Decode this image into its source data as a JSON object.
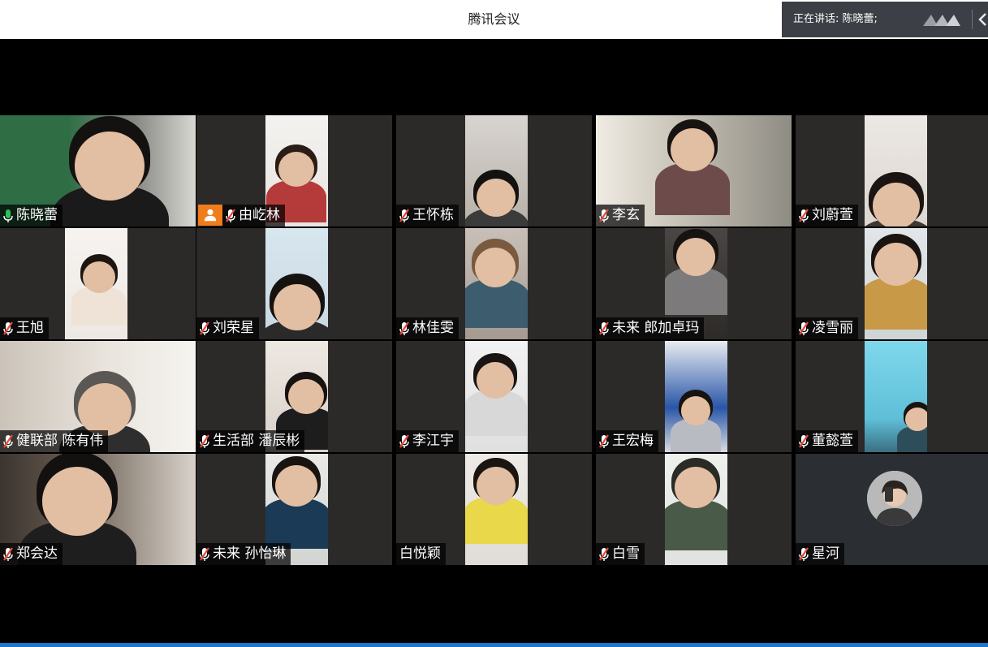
{
  "app": {
    "title": "腾讯会议"
  },
  "speaker": {
    "label": "正在讲话: 陈晓蕾;"
  },
  "colors": {
    "active_speaker_border": "#2fbf5a",
    "mic_active": "#2fbf5a",
    "mic_muted": "#e24a3b",
    "host_badge": "#f07c1b",
    "tile_background": "#2c2a28"
  },
  "icons": {
    "mic_active": "microphone-icon",
    "mic_muted": "muted-microphone-icon",
    "host": "host-person-icon",
    "logo": "tencent-meeting-logo-icon",
    "collapse": "chevron-left-icon"
  },
  "participants": [
    {
      "name": "陈晓蕾",
      "mic": "active",
      "host": false,
      "active": true
    },
    {
      "name": "由屹林",
      "mic": "muted",
      "host": true,
      "active": false
    },
    {
      "name": "王怀栋",
      "mic": "muted",
      "host": false,
      "active": false
    },
    {
      "name": "李玄",
      "mic": "muted",
      "host": false,
      "active": false
    },
    {
      "name": "刘蔚萱",
      "mic": "muted",
      "host": false,
      "active": false
    },
    {
      "name": "王旭",
      "mic": "muted",
      "host": false,
      "active": false
    },
    {
      "name": "刘荣星",
      "mic": "muted",
      "host": false,
      "active": false
    },
    {
      "name": "林佳雯",
      "mic": "muted",
      "host": false,
      "active": false
    },
    {
      "name": "未来 郎加卓玛",
      "mic": "muted",
      "host": false,
      "active": false
    },
    {
      "name": "凌雪丽",
      "mic": "muted",
      "host": false,
      "active": false
    },
    {
      "name": "健联部 陈有伟",
      "mic": "muted",
      "host": false,
      "active": false
    },
    {
      "name": "生活部 潘辰彬",
      "mic": "muted",
      "host": false,
      "active": false
    },
    {
      "name": "李江宇",
      "mic": "muted",
      "host": false,
      "active": false
    },
    {
      "name": "王宏梅",
      "mic": "muted",
      "host": false,
      "active": false
    },
    {
      "name": "董懿萱",
      "mic": "muted",
      "host": false,
      "active": false
    },
    {
      "name": "郑会达",
      "mic": "muted",
      "host": false,
      "active": false
    },
    {
      "name": "未来 孙怡琳",
      "mic": "muted",
      "host": false,
      "active": false
    },
    {
      "name": "白悦颖",
      "mic": "none",
      "host": false,
      "active": false
    },
    {
      "name": "白雪",
      "mic": "muted",
      "host": false,
      "active": false
    },
    {
      "name": "星河",
      "mic": "muted",
      "host": false,
      "active": false
    }
  ]
}
